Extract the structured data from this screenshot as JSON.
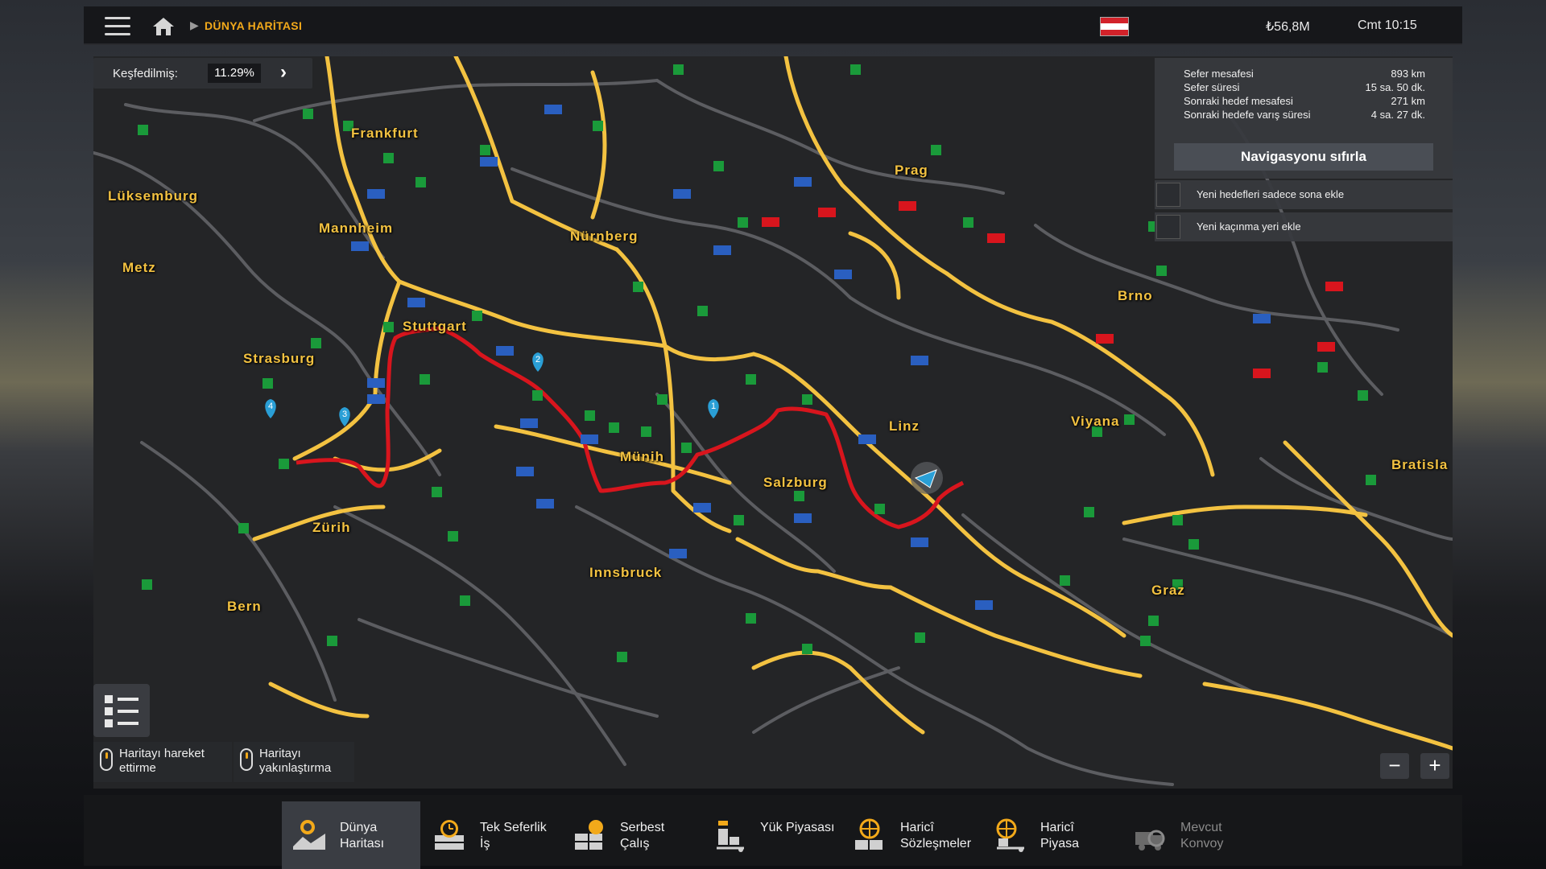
{
  "topbar": {
    "breadcrumb": "DÜNYA HARİTASI",
    "money": "₺56,8M",
    "clock": "Cmt 10:15",
    "flag_colors": [
      "#d2222a",
      "#ffffff",
      "#d2222a"
    ]
  },
  "explored": {
    "label": "Keşfedilmiş:",
    "value": "11.29%"
  },
  "route_info": {
    "rows": [
      {
        "label": "Sefer mesafesi",
        "value": "893 km"
      },
      {
        "label": "Sefer süresi",
        "value": "15 sa. 50 dk."
      },
      {
        "label": "Sonraki hedef mesafesi",
        "value": "271 km"
      },
      {
        "label": "Sonraki hedefe varış süresi",
        "value": "4 sa. 27 dk."
      }
    ],
    "reset_label": "Navigasyonu sıfırla",
    "options": [
      {
        "label": "Yeni hedefleri sadece sona ekle"
      },
      {
        "label": "Yeni kaçınma yeri ekle"
      }
    ]
  },
  "cities": [
    "Frankfurt",
    "Lüksemburg",
    "Mannheim",
    "Metz",
    "Nürnberg",
    "Prag",
    "Brno",
    "Stuttgart",
    "Strasburg",
    "Linz",
    "Viyana",
    "Münih",
    "Salzburg",
    "Bratisla",
    "Zürih",
    "Innsbruck",
    "Graz",
    "Bern"
  ],
  "hints": {
    "move": "Haritayı hareket\nettirme",
    "zoom": "Haritayı\nyakınlaştırma"
  },
  "zoom": {
    "minus": "−",
    "plus": "+"
  },
  "tabs": [
    {
      "label": "Dünya\nHaritası",
      "icon": "world-map-icon"
    },
    {
      "label": "Tek Seferlik\nİş",
      "icon": "single-job-icon"
    },
    {
      "label": "Serbest\nÇalış",
      "icon": "freelance-icon"
    },
    {
      "label": "Yük Piyasası",
      "icon": "cargo-market-icon"
    },
    {
      "label": "Haricî\nSözleşmeler",
      "icon": "external-contracts-icon"
    },
    {
      "label": "Haricî\nPiyasa",
      "icon": "external-market-icon"
    },
    {
      "label": "Mevcut\nKonvoy",
      "icon": "convoy-icon"
    }
  ],
  "colors": {
    "accent": "#f2a91a",
    "route": "#d8151d",
    "highway": "#f3c241",
    "road": "#5c5d61"
  }
}
